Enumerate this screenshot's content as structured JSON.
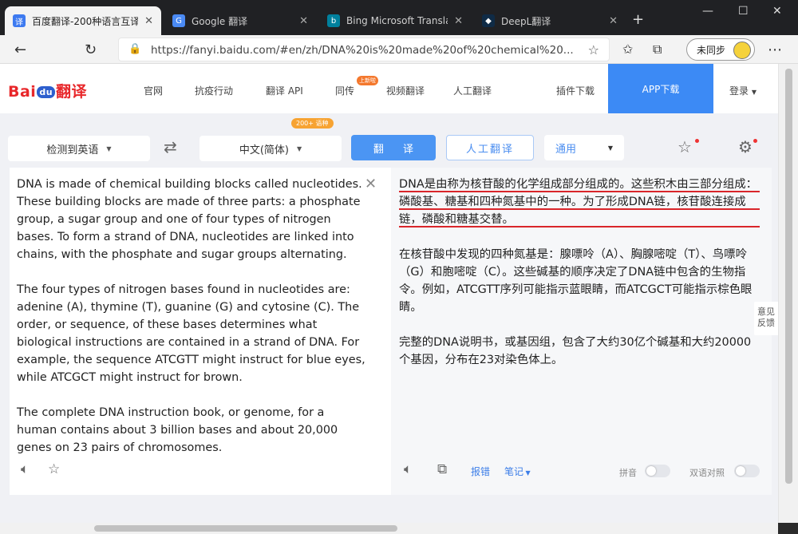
{
  "browser": {
    "tabs": [
      {
        "title": "百度翻译-200种语言互译",
        "favicon_color": "#3d7af0"
      },
      {
        "title": "Google 翻译",
        "favicon_color": "#4a8af4"
      },
      {
        "title": "Bing Microsoft Translator",
        "favicon_color": "#00809d"
      },
      {
        "title": "DeepL翻译",
        "favicon_color": "#0f2b46"
      }
    ],
    "url": "https://fanyi.baidu.com/#en/zh/DNA%20is%20made%20of%20chemical%20...",
    "sync_label": "未同步"
  },
  "header": {
    "logo_text_left": "Bai",
    "logo_text_paw": "du",
    "logo_text_right": "翻译",
    "nav": [
      "官网",
      "抗疫行动",
      "翻译 API",
      "同传",
      "视频翻译",
      "人工翻译",
      "插件下载"
    ],
    "new_badge": "上新啦",
    "app_download": "APP下载",
    "login": "登录"
  },
  "toolbar": {
    "source_lang": "检测到英语",
    "target_lang": "中文(简体)",
    "badge": "200+ 语种",
    "translate_label": "翻 译",
    "human_translate_label": "人工翻译",
    "domain": "通用"
  },
  "source": {
    "paragraphs": [
      "DNA is made of chemical building blocks called nucleotides. These building blocks are made of three parts: a phosphate group, a sugar group and one of four types of nitrogen bases. To form a strand of DNA, nucleotides are linked into chains, with the phosphate and sugar groups alternating.",
      "The four types of nitrogen bases found in nucleotides are: adenine (A), thymine (T), guanine (G) and cytosine (C). The order, or sequence, of these bases determines what biological instructions are contained in a strand of DNA. For example, the sequence ATCGTT might instruct for blue eyes, while ATCGCT might instruct for brown.",
      "The complete DNA instruction book, or genome, for a human contains about 3 billion bases and about 20,000 genes on 23 pairs of chromosomes."
    ]
  },
  "target": {
    "paragraphs": [
      "DNA是由称为核苷酸的化学组成部分组成的。这些积木由三部分组成：磷酸基、糖基和四种氮基中的一种。为了形成DNA链，核苷酸连接成链，磷酸和糖基交替。",
      "在核苷酸中发现的四种氮基是：腺嘌呤（A）、胸腺嘧啶（T）、鸟嘌呤（G）和胞嘧啶（C）。这些碱基的顺序决定了DNA链中包含的生物指令。例如，ATCGTT序列可能指示蓝眼睛，而ATCGCT可能指示棕色眼睛。",
      "完整的DNA说明书，或基因组，包含了大约30亿个碱基和大约20000个基因，分布在23对染色体上。"
    ],
    "footer": {
      "dict_label": "报错",
      "notes_label": "笔记",
      "pinyin_label": "拼音",
      "bilingual_label": "双语对照"
    }
  },
  "feedback": "意见反馈"
}
